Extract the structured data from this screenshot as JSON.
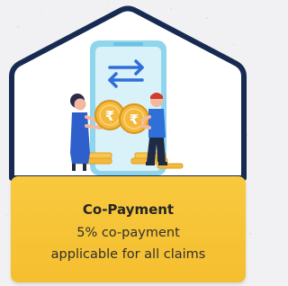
{
  "card": {
    "title": "Co-Payment",
    "description_line1": "5% co-payment",
    "description_line2": "applicable for all claims"
  },
  "illustration": {
    "currency_symbol": "₹",
    "icons": [
      "phone-icon",
      "transfer-arrows-icon",
      "rupee-coin-icon",
      "person-woman-icon",
      "person-man-icon",
      "coin-stack-icon"
    ]
  },
  "colors": {
    "background": "#f1f1f3",
    "house_outline": "#172a52",
    "info_box": "#f7c43a",
    "phone_frame": "#8fd6ec",
    "arrows": "#2e6fd8",
    "coin": "#f3b83c"
  }
}
